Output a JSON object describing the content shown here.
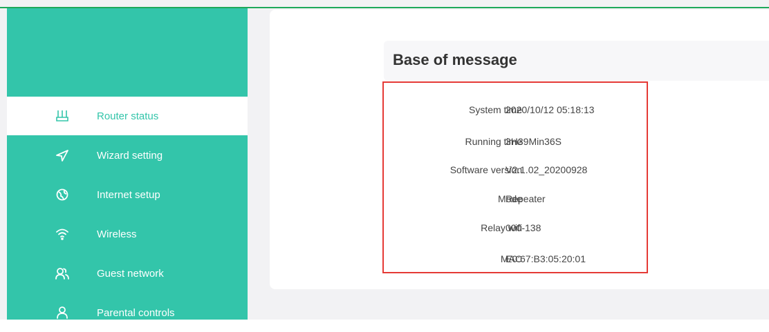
{
  "sidebar": {
    "items": [
      {
        "label": "Router status",
        "icon": "router-icon",
        "active": true
      },
      {
        "label": "Wizard setting",
        "icon": "send-icon",
        "active": false
      },
      {
        "label": "Internet setup",
        "icon": "globe-icon",
        "active": false
      },
      {
        "label": "Wireless",
        "icon": "wifi-icon",
        "active": false
      },
      {
        "label": "Guest network",
        "icon": "users-icon",
        "active": false
      },
      {
        "label": "Parental controls",
        "icon": "user-icon",
        "active": false
      }
    ]
  },
  "main": {
    "section_title": "Base of message",
    "info": [
      {
        "label": "System time",
        "value": "2020/10/12 05:18:13"
      },
      {
        "label": "Running time",
        "value": "3H39Min36S"
      },
      {
        "label": "Software version",
        "value": "V2.1.02_20200928"
      },
      {
        "label": "Mode",
        "value": "Repeater"
      },
      {
        "label": "Relay wifi",
        "value": "000-138"
      },
      {
        "label": "MAC",
        "value": "E0:67:B3:05:20:01"
      }
    ]
  },
  "colors": {
    "accent": "#33c5aa",
    "highlight": "#e53935",
    "top_line": "#1ea95a"
  }
}
